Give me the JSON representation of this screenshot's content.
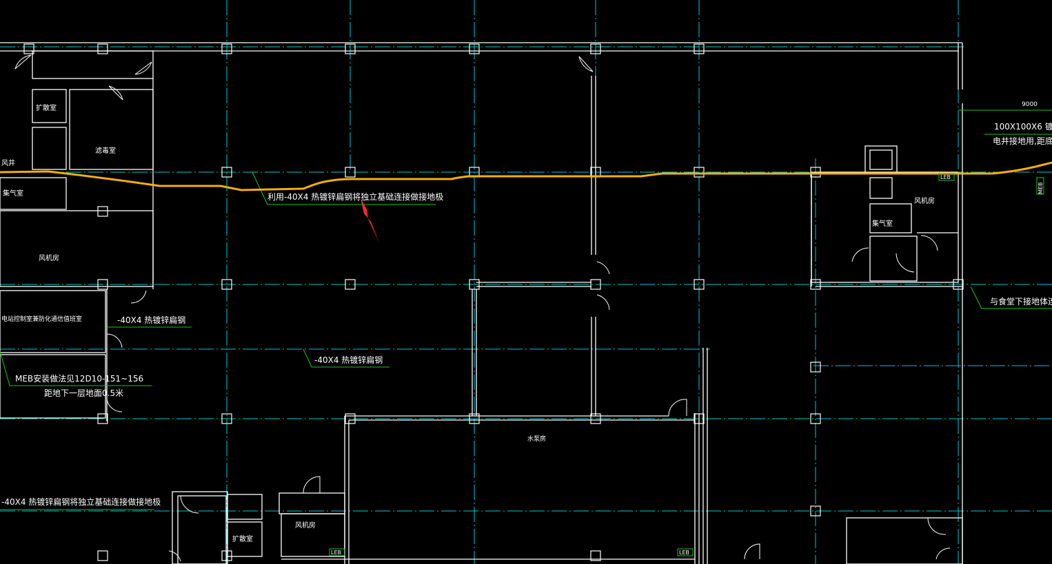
{
  "colors": {
    "background": "#000000",
    "wall": "#ffffff",
    "axis": "#00c8d8",
    "leader": "#19c819",
    "grounding": "#f5b000",
    "arrow": "#ff2a2a",
    "room_text": "#ffffff"
  },
  "rooms": {
    "expansion_1": "扩散室",
    "filter": "滤毒室",
    "shaft": "风井",
    "gas_collect_1": "集气室",
    "fan_room_1": "风机房",
    "power_station": "电站控制室兼防化通信值班室",
    "fan_room_2": "风机房",
    "gas_collect_2": "集气室",
    "pump_room": "水泵房",
    "fan_room_3": "风机房",
    "expansion_2": "扩散室"
  },
  "annotations": {
    "main_note": "利用-40X4 热镀锌扁钢将独立基础连接做接地极",
    "flat_steel_1": "-40X4 热镀锌扁钢",
    "flat_steel_2": "-40X4 热镀锌扁钢",
    "meb_install": "MEB安装做法见12D10-151~156",
    "meb_height": "距地下一层地面0.5米",
    "bottom_note": "-40X4 热镀锌扁钢将独立基础连接做接地极",
    "dim_9000": "9000",
    "right_note_1": "100X100X6 镀",
    "right_note_2": "电井接地用,距底",
    "right_note_3": "与食堂下接地体连"
  },
  "tags": {
    "leb_1": "LEB",
    "leb_2": "LEB",
    "leb_3": "LEB",
    "meb": "MEB"
  },
  "icons": {
    "arrow": "red-arrow-icon"
  }
}
